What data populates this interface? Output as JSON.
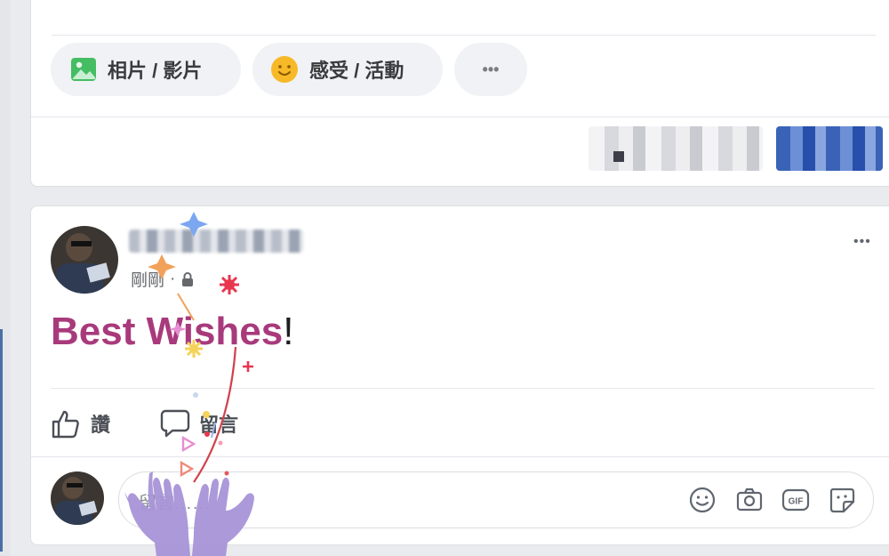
{
  "composer": {
    "photo_label": "相片 / 影片",
    "feeling_label": "感受 / 活動",
    "more_label": "•••"
  },
  "post": {
    "time": "剛剛",
    "text_highlight": "Best Wishes",
    "text_punct": "!",
    "more_label": "•••",
    "like_label": "讚",
    "comment_label": "留言",
    "comment_placeholder": "留言……"
  },
  "icons": [
    "photo-icon",
    "feeling-icon",
    "lock-icon",
    "like-icon",
    "comment-icon",
    "emoji-icon",
    "camera-icon",
    "gif-icon",
    "sticker-icon"
  ],
  "colors": {
    "highlight": "#a83a7c",
    "photo_green": "#45bd62",
    "feeling_yellow": "#f7b928"
  }
}
